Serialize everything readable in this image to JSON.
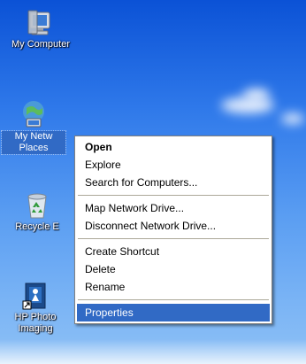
{
  "desktop": {
    "icons": [
      {
        "id": "my-computer",
        "label": "My Computer",
        "icon": "my-computer-icon"
      },
      {
        "id": "my-network",
        "label_line1": "My Netw",
        "label_line2": "Places",
        "icon": "network-places-icon"
      },
      {
        "id": "recycle",
        "label": "Recycle E",
        "icon": "recycle-bin-icon"
      },
      {
        "id": "hp",
        "label_line1": "HP Photo",
        "label_line2": "Imaging",
        "icon": "hp-photo-imaging-icon"
      }
    ]
  },
  "context_menu": {
    "items": [
      {
        "label": "Open",
        "bold": true
      },
      {
        "label": "Explore"
      },
      {
        "label": "Search for Computers..."
      },
      {
        "separator": true
      },
      {
        "label": "Map Network Drive..."
      },
      {
        "label": "Disconnect Network Drive..."
      },
      {
        "separator": true
      },
      {
        "label": "Create Shortcut"
      },
      {
        "label": "Delete"
      },
      {
        "label": "Rename"
      },
      {
        "separator": true
      },
      {
        "label": "Properties",
        "highlighted": true
      }
    ]
  },
  "colors": {
    "highlight": "#316ac5",
    "desktop_top": "#0b52d6",
    "desktop_bottom": "#8ec1f5"
  }
}
